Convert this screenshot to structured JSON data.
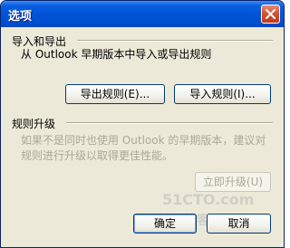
{
  "window": {
    "title": "选项",
    "close_icon": "close-icon"
  },
  "import_export": {
    "section_title": "导入和导出",
    "description": "从 Outlook 早期版本中导入或导出规则",
    "export_button": "导出规则(E)...",
    "import_button": "导入规则(I)..."
  },
  "upgrade": {
    "section_title": "规则升级",
    "description_line1": "如果不是同时也使用 Outlook 的早期版本，建议对",
    "description_line2": "规则进行升级以取得更佳性能。",
    "upgrade_button": "立即升级(U)"
  },
  "footer": {
    "ok_button": "确定",
    "cancel_button": "取消"
  },
  "watermark": {
    "line1": "51CTO.com",
    "line2": "技术博客 Blog"
  },
  "colors": {
    "title_bar": "#0052d6",
    "face": "#ece9d8",
    "disabled_text": "#aca899"
  }
}
